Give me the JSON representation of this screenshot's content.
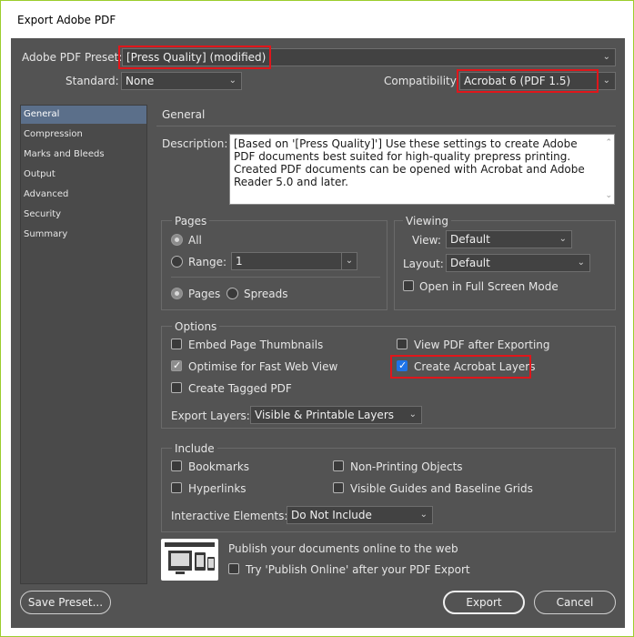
{
  "window": {
    "title": "Export Adobe PDF"
  },
  "preset": {
    "label": "Adobe PDF Preset:",
    "value": "[Press Quality] (modified)"
  },
  "standard": {
    "label": "Standard:",
    "value": "None"
  },
  "compatibility": {
    "label": "Compatibility:",
    "value": "Acrobat 6 (PDF 1.5)"
  },
  "sidebar": {
    "items": [
      {
        "label": "General"
      },
      {
        "label": "Compression"
      },
      {
        "label": "Marks and Bleeds"
      },
      {
        "label": "Output"
      },
      {
        "label": "Advanced"
      },
      {
        "label": "Security"
      },
      {
        "label": "Summary"
      }
    ]
  },
  "general": {
    "heading": "General",
    "description_label": "Description:",
    "description": "[Based on '[Press Quality]'] Use these settings to create Adobe PDF documents best suited for high-quality prepress printing.  Created PDF documents can be opened with Acrobat and Adobe Reader 5.0 and later."
  },
  "pages": {
    "title": "Pages",
    "all_label": "All",
    "range_label": "Range:",
    "range_value": "1",
    "pages_label": "Pages",
    "spreads_label": "Spreads",
    "all_selected": true,
    "pages_selected": true
  },
  "viewing": {
    "title": "Viewing",
    "view_label": "View:",
    "view_value": "Default",
    "layout_label": "Layout:",
    "layout_value": "Default",
    "fullscreen_label": "Open in Full Screen Mode",
    "fullscreen_checked": false
  },
  "options": {
    "title": "Options",
    "embed_thumbnails": {
      "label": "Embed Page Thumbnails",
      "checked": false
    },
    "optimise_web": {
      "label": "Optimise for Fast Web View",
      "checked": true
    },
    "tagged_pdf": {
      "label": "Create Tagged PDF",
      "checked": false
    },
    "view_after": {
      "label": "View PDF after Exporting",
      "checked": false
    },
    "acrobat_layers": {
      "label": "Create Acrobat Layers",
      "checked": true
    },
    "export_layers_label": "Export Layers:",
    "export_layers_value": "Visible & Printable Layers"
  },
  "include": {
    "title": "Include",
    "bookmarks": {
      "label": "Bookmarks",
      "checked": false
    },
    "hyperlinks": {
      "label": "Hyperlinks",
      "checked": false
    },
    "non_printing": {
      "label": "Non-Printing Objects",
      "checked": false
    },
    "visible_guides": {
      "label": "Visible Guides and Baseline Grids",
      "checked": false
    },
    "interactive_label": "Interactive Elements:",
    "interactive_value": "Do Not Include"
  },
  "publish": {
    "heading": "Publish your documents online to the web",
    "checkbox_label": "Try 'Publish Online' after your PDF Export",
    "checked": false
  },
  "footer": {
    "save_preset": "Save Preset...",
    "export": "Export",
    "cancel": "Cancel"
  },
  "colors": {
    "dialog_bg": "#535353",
    "highlight_red": "#e0161b",
    "check_blue": "#1e73e8",
    "sidebar_active": "#5b6f8a"
  }
}
